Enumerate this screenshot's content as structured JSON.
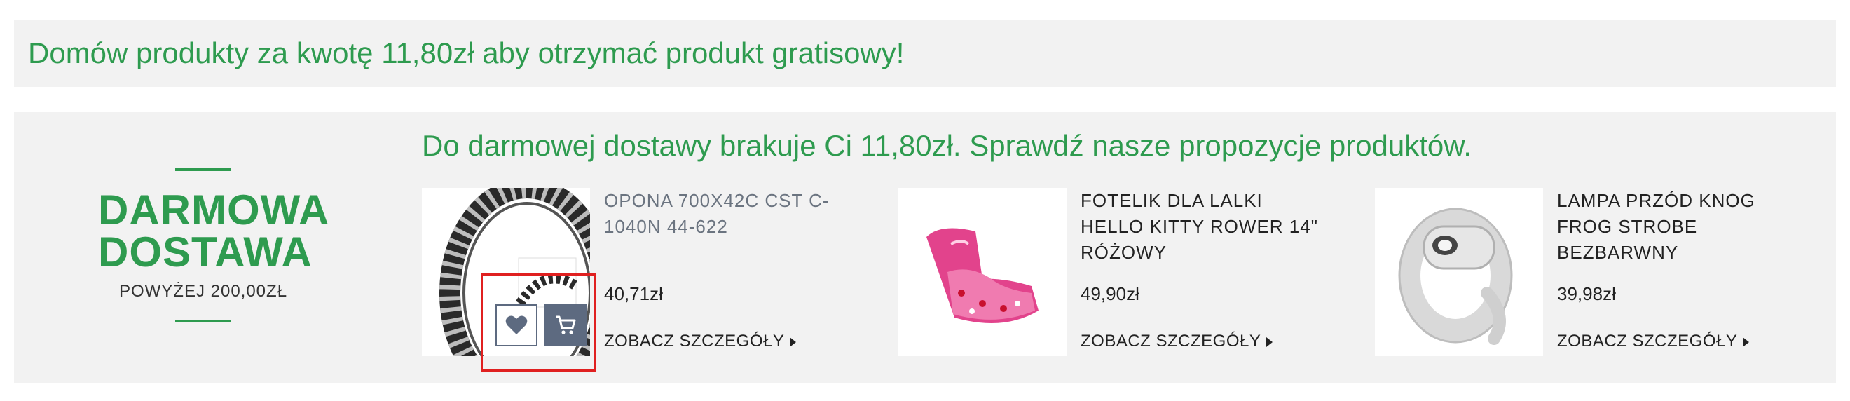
{
  "gift_banner": {
    "text": "Domów produkty za kwotę 11,80zł aby otrzymać produkt gratisowy!"
  },
  "free_delivery": {
    "title_line1": "DARMOWA",
    "title_line2": "DOSTAWA",
    "threshold": "POWYŻEJ 200,00ZŁ"
  },
  "recommendations": {
    "headline": "Do darmowej dostawy brakuje Ci 11,80zł. Sprawdź nasze propozycje produktów.",
    "details_label": "ZOBACZ SZCZEGÓŁY",
    "products": [
      {
        "name": "OPONA 700X42C CST C-1040N 44-622",
        "price": "40,71zł",
        "image": "bicycle-tire"
      },
      {
        "name": "FOTELIK DLA LALKI HELLO KITTY ROWER 14\" RÓŻOWY",
        "price": "49,90zł",
        "image": "pink-doll-seat"
      },
      {
        "name": "LAMPA PRZÓD KNOG FROG STROBE BEZBARWNY",
        "price": "39,98zł",
        "image": "white-bike-lamp"
      }
    ]
  },
  "actions": {
    "wishlist_icon": "heart-icon",
    "cart_icon": "cart-icon"
  },
  "colors": {
    "accent_green": "#2e9b4f",
    "panel_bg": "#f2f2f2",
    "button_slate": "#5d6a80",
    "highlight_red": "#e02020"
  }
}
